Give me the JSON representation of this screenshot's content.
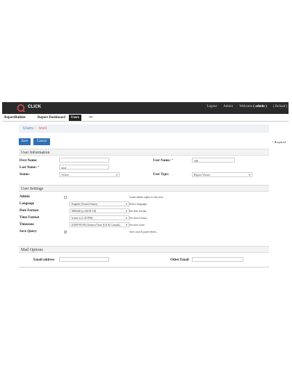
{
  "app": {
    "logo_text": "CLICK",
    "brand_color": "#d9534f",
    "top_links": {
      "logout": "Logout",
      "admin": "Admin",
      "welcome_prefix": "Welcome",
      "welcome_user": "( admin )",
      "reload": "[ Reload ]"
    }
  },
  "nav": {
    "tabs": [
      "ReportBuilder",
      "Report Dashboard",
      "Users",
      "•••"
    ],
    "active_tab": "Users"
  },
  "breadcrumb": {
    "parent": "Users",
    "separator": "/",
    "current": "test1"
  },
  "toolbar": {
    "save_label": "Save",
    "cancel_label": "Cancel",
    "required_marker": "*",
    "required_label": "Required"
  },
  "user_info": {
    "title": "User Information",
    "first_name_label": "First Name:",
    "first_name_value": "",
    "last_name_label": "Last Name:",
    "last_name_value": "test1",
    "status_label": "Status:",
    "status_value": "Active",
    "user_name_label": "User Name:",
    "user_name_value": "100",
    "user_type_label": "User Type:",
    "user_type_value": "Report Viewer",
    "required_marker": "*"
  },
  "user_settings": {
    "title": "User Settings",
    "admin_label": "Admin",
    "admin_checked": false,
    "admin_hint": "Grant admin rights to this user.",
    "language_label": "Language",
    "language_value": "English (United States)",
    "language_hint": "Select language.",
    "date_format_label": "Date Format",
    "date_format_value": "MM/dd/yy (06/01/18)",
    "date_format_hint": "Set date format.",
    "time_format_label": "Time Format",
    "time_format_value": "h:mm tt (1:45 PM)",
    "time_format_hint": "Set time format.",
    "timezone_label": "Timezone",
    "timezone_value": "(GMT-05:00) Eastern Time (US & Canada)",
    "timezone_hint": "Set time zone.",
    "save_query_label": "Save Query",
    "save_query_checked": true,
    "save_query_hint": "Save search panel filters."
  },
  "mail_options": {
    "title": "Mail Options",
    "email_label": "Email address",
    "email_value": "",
    "other_email_label": "Other Email",
    "other_email_value": ""
  }
}
